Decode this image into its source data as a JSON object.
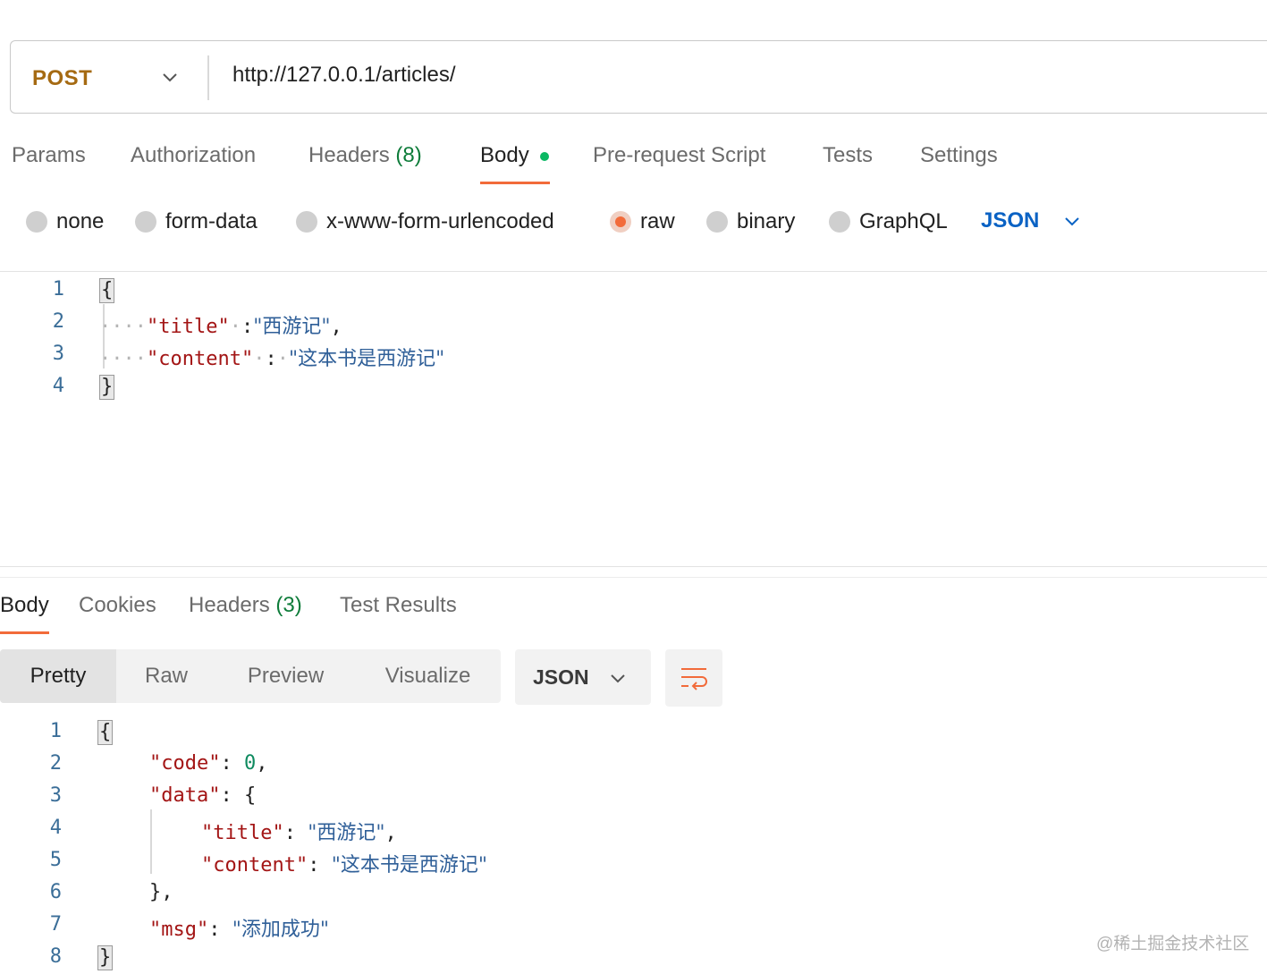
{
  "request": {
    "method": "POST",
    "url": "http://127.0.0.1/articles/",
    "tabs": [
      {
        "label": "Params"
      },
      {
        "label": "Authorization"
      },
      {
        "label": "Headers",
        "count": "(8)"
      },
      {
        "label": "Body"
      },
      {
        "label": "Pre-request Script"
      },
      {
        "label": "Tests"
      },
      {
        "label": "Settings"
      }
    ],
    "body_types": [
      "none",
      "form-data",
      "x-www-form-urlencoded",
      "raw",
      "binary",
      "GraphQL"
    ],
    "selected_body_type": "raw",
    "format": "JSON",
    "line_numbers": [
      "1",
      "2",
      "3",
      "4"
    ],
    "code": {
      "open_brace": "{",
      "title_key": "\"title\"",
      "title_value": "\"西游记\"",
      "content_key": "\"content\"",
      "content_value": "\"这本书是西游记\"",
      "close_brace": "}"
    }
  },
  "response": {
    "tabs": [
      {
        "label": "Body"
      },
      {
        "label": "Cookies"
      },
      {
        "label": "Headers",
        "count": "(3)"
      },
      {
        "label": "Test Results"
      }
    ],
    "views": [
      "Pretty",
      "Raw",
      "Preview",
      "Visualize"
    ],
    "format": "JSON",
    "line_numbers": [
      "1",
      "2",
      "3",
      "4",
      "5",
      "6",
      "7",
      "8"
    ],
    "code": {
      "open_brace": "{",
      "code_key": "\"code\"",
      "code_value": "0",
      "data_key": "\"data\"",
      "data_open": "{",
      "title_key": "\"title\"",
      "title_value": "\"西游记\"",
      "content_key": "\"content\"",
      "content_value": "\"这本书是西游记\"",
      "data_close": "}",
      "msg_key": "\"msg\"",
      "msg_value": "\"添加成功\"",
      "close_brace": "}"
    }
  },
  "watermark": "@稀土掘金技术社区",
  "colors": {
    "method": "#a56a12",
    "accent": "#f26b3a",
    "count": "#0e7c3a",
    "json_link": "#0a62c4",
    "key": "#a31515",
    "string": "#2f5f98",
    "number": "#0e8a5f"
  }
}
